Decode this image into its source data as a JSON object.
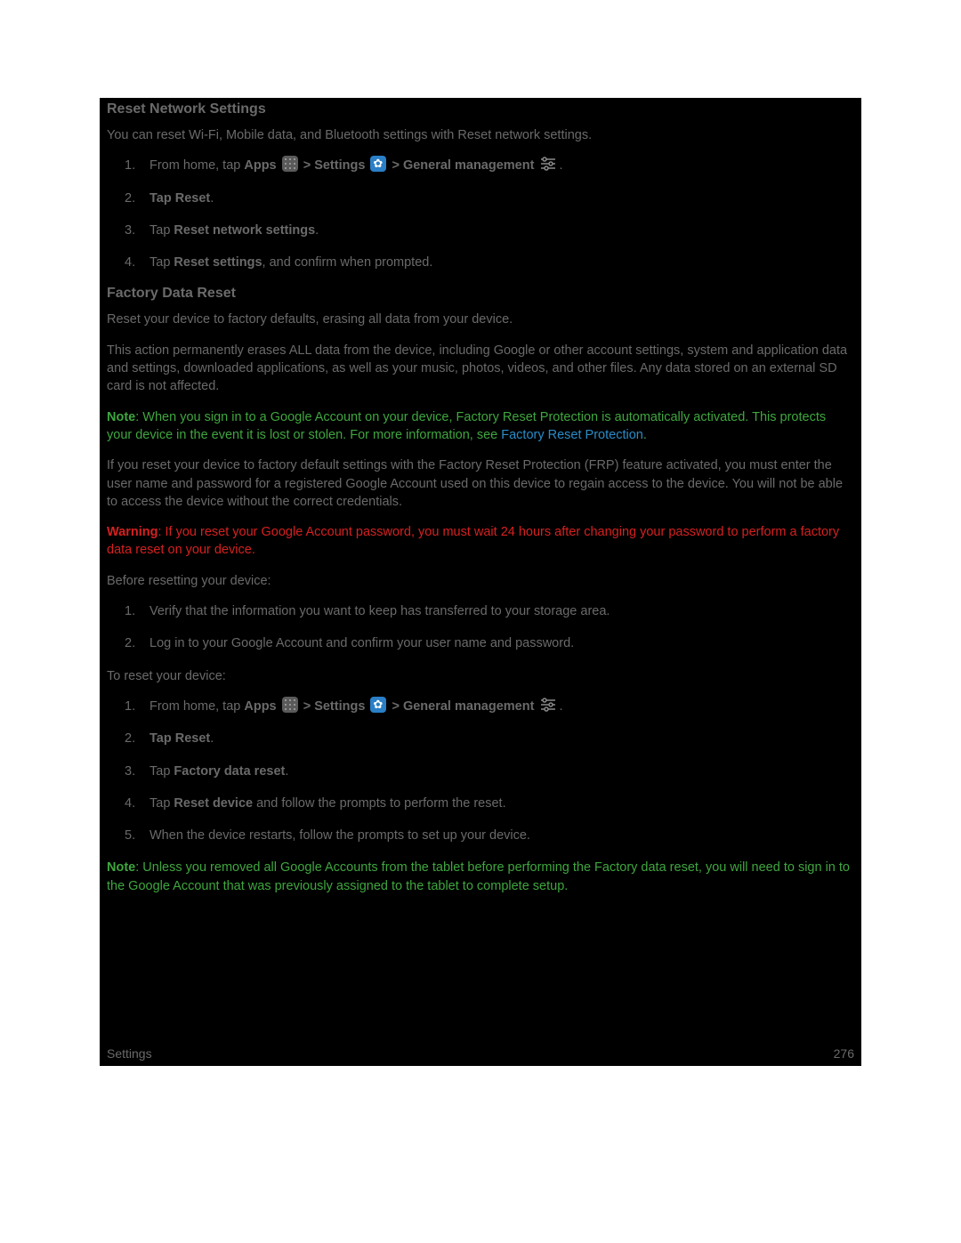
{
  "section1": {
    "heading": "Reset Network Settings",
    "intro": "You can reset Wi-Fi, Mobile data, and Bluetooth settings with Reset network settings.",
    "steps": {
      "s1": {
        "prefix": "From home, tap ",
        "apps": "Apps",
        "gt1": " > ",
        "settings": "Settings",
        "gt2": " > ",
        "general": "General management",
        "suffix": "."
      },
      "s2_tap": "Tap ",
      "s2_reset": "Reset",
      "s2_period": ".",
      "s3_tap": "Tap ",
      "s3_bold": "Reset network settings",
      "s3_period": ".",
      "s4_tap": "Tap ",
      "s4_bold": "Reset settings",
      "s4_rest": ", and confirm when prompted."
    }
  },
  "section2": {
    "heading": "Factory Data Reset",
    "p1": "Reset your device to factory defaults, erasing all data from your device.",
    "p2": "This action permanently erases ALL data from the device, including Google or other account settings, system and application data and settings, downloaded applications, as well as your music, photos, videos, and other files. Any data stored on an external SD card is not affected.",
    "note1": {
      "label": "Note",
      "text": ": When you sign in to a Google Account on your device, Factory Reset Protection is automatically activated. This protects your device in the event it is lost or stolen. For more information, see ",
      "link": "Factory Reset Protection",
      "period": "."
    },
    "p3": "If you reset your device to factory default settings with the Factory Reset Protection (FRP) feature activated, you must enter the user name and password for a registered Google Account used on this device to regain access to the device. You will not be able to access the device without the correct credentials.",
    "warning": {
      "label": "Warning",
      "text": ": If you reset your Google Account password, you must wait 24 hours after changing your password to perform a factory data reset on your device."
    },
    "p4": "Before resetting your device:",
    "presteps": {
      "s1": "Verify that the information you want to keep has transferred to your storage area.",
      "s2": "Log in to your Google Account and confirm your user name and password."
    },
    "p5": "To reset your device:",
    "resetsteps": {
      "s1": {
        "prefix": "From home, tap ",
        "apps": "Apps",
        "gt1": " > ",
        "settings": "Settings",
        "gt2": " > ",
        "general": "General management",
        "suffix": "."
      },
      "s2_tap": "Tap ",
      "s2_reset": "Reset",
      "s2_period": ".",
      "s3_tap": "Tap ",
      "s3_bold": "Factory data reset",
      "s3_period": ".",
      "s4_tap": "Tap ",
      "s4_bold": "Reset device",
      "s4_rest": " and follow the prompts to perform the reset.",
      "s5": "When the device restarts, follow the prompts to set up your device."
    },
    "note2": {
      "label": "Note",
      "text": ": Unless you removed all Google Accounts from the tablet before performing the Factory data reset, you will need to sign in to the Google Account that was previously assigned to the tablet to complete setup."
    }
  },
  "footer": {
    "left": "Settings",
    "right": "276"
  }
}
